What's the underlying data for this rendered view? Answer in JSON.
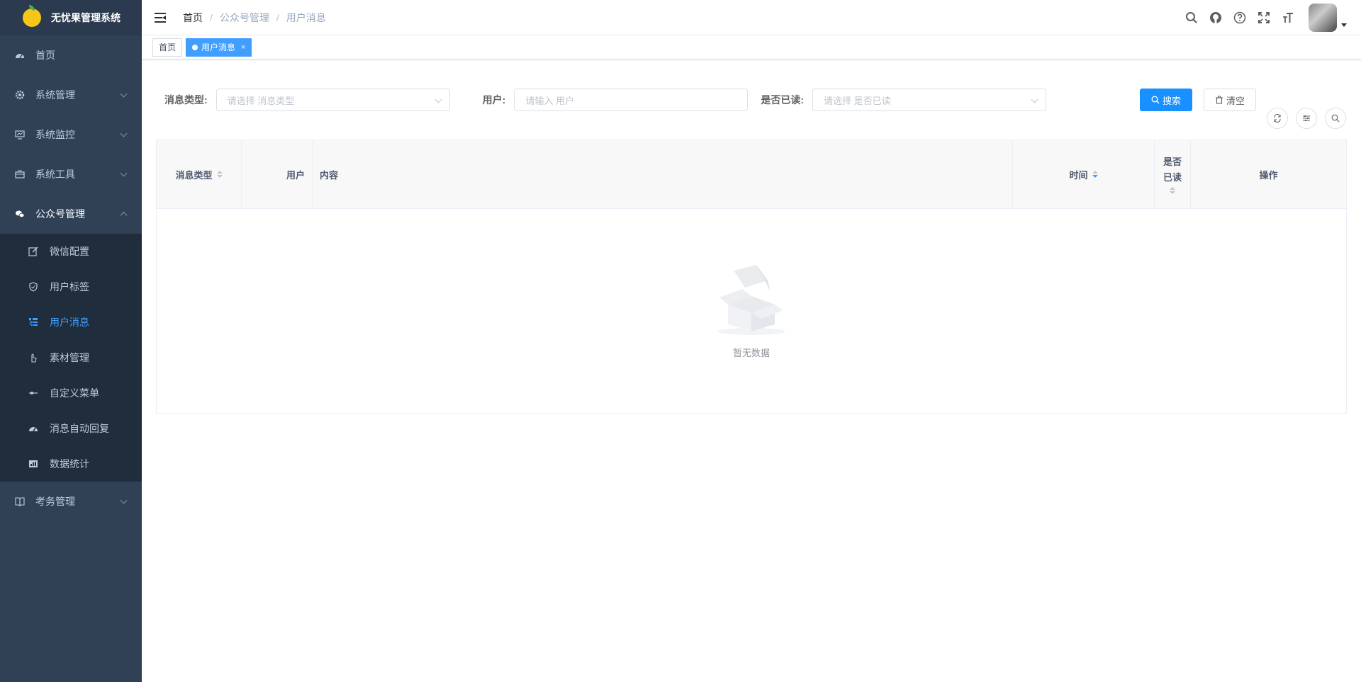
{
  "app": {
    "title": "无忧果管理系统"
  },
  "sidebar": {
    "items": [
      {
        "label": "首页",
        "icon": "dashboard-icon"
      },
      {
        "label": "系统管理",
        "icon": "gear-icon"
      },
      {
        "label": "系统监控",
        "icon": "monitor-icon"
      },
      {
        "label": "系统工具",
        "icon": "toolbox-icon"
      },
      {
        "label": "公众号管理",
        "icon": "wechat-icon"
      },
      {
        "label": "考务管理",
        "icon": "book-icon"
      }
    ],
    "wechat_sub": [
      {
        "label": "微信配置",
        "icon": "edit-icon"
      },
      {
        "label": "用户标签",
        "icon": "shield-icon"
      },
      {
        "label": "用户消息",
        "icon": "tree-table-icon"
      },
      {
        "label": "素材管理",
        "icon": "hand-icon"
      },
      {
        "label": "自定义菜单",
        "icon": "slider-icon"
      },
      {
        "label": "消息自动回复",
        "icon": "dashboard-icon"
      },
      {
        "label": "数据统计",
        "icon": "chart-icon"
      }
    ]
  },
  "breadcrumb": [
    "首页",
    "公众号管理",
    "用户消息"
  ],
  "tags": [
    {
      "label": "首页",
      "active": false
    },
    {
      "label": "用户消息",
      "active": true,
      "close": "×"
    }
  ],
  "search": {
    "msg_type_label": "消息类型:",
    "msg_type_placeholder": "请选择 消息类型",
    "user_label": "用户:",
    "user_placeholder": "请输入 用户",
    "read_label": "是否已读:",
    "read_placeholder": "请选择 是否已读",
    "search_btn": "搜索",
    "clear_btn": "清空"
  },
  "table": {
    "columns": [
      "消息类型",
      "用户",
      "内容",
      "时间",
      "是否已读",
      "操作"
    ],
    "empty_text": "暂无数据"
  },
  "colors": {
    "accent": "#1890ff",
    "sidebar": "#304156",
    "submenu": "#1f2d3d"
  }
}
